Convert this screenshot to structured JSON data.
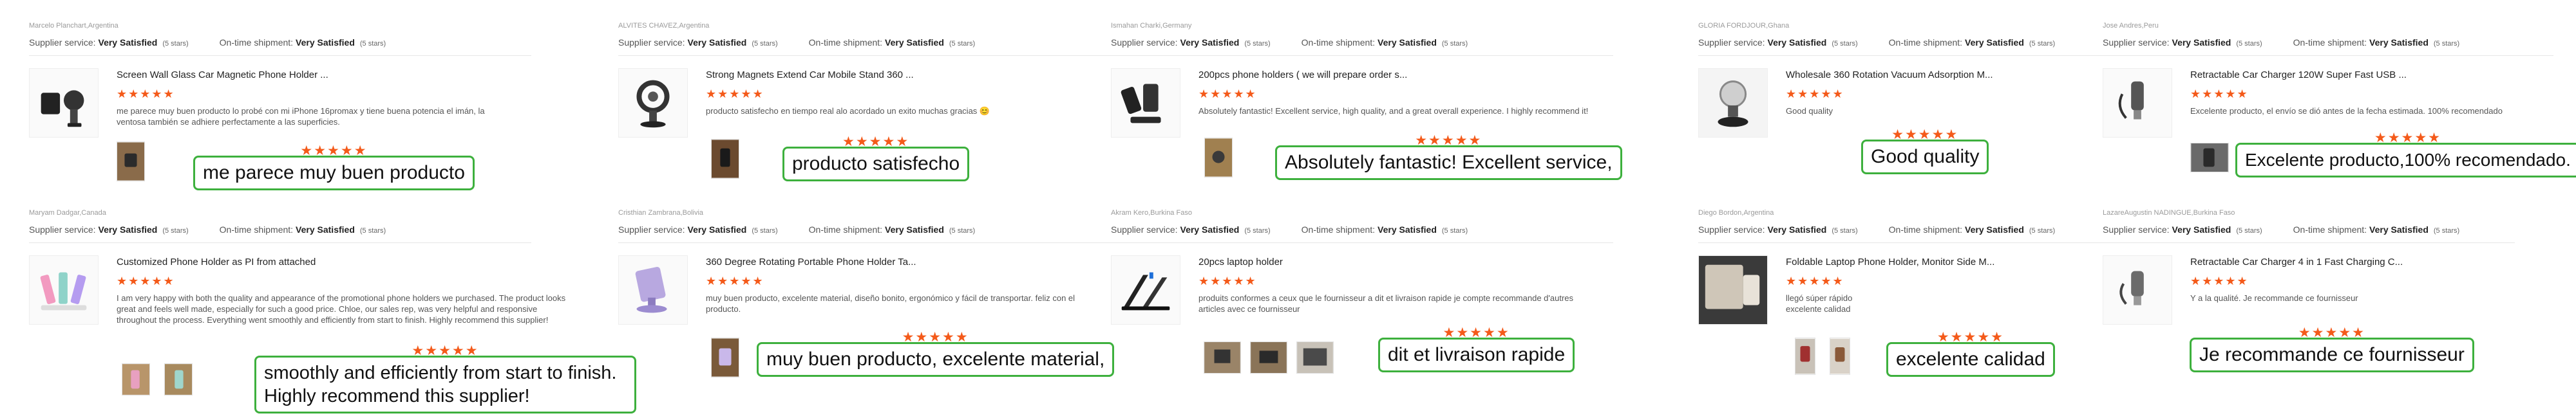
{
  "labels": {
    "supplier_service": "Supplier service:",
    "on_time_shipment": "On-time shipment:"
  },
  "stars_glyph": "★★★★★",
  "colors": {
    "star": "#f45a1a",
    "highlight_border": "#3db03d",
    "divider": "#e6e6e6"
  },
  "reviews": [
    {
      "reviewer": "Marcelo Planchart,Argentina",
      "supplier_value": "Very Satisfied",
      "supplier_stars": "(5 stars)",
      "shipment_value": "Very Satisfied",
      "shipment_stars": "(5 stars)",
      "product_title": "Screen Wall Glass Car Magnetic Phone Holder ...",
      "review_text": "me parece muy buen producto lo probé con mi iPhone 16promax y tiene buena potencia el imán, la ventosa también se adhiere perfectamente a las superficies.",
      "highlight": "me parece muy buen producto",
      "thumb_icon": "magnetic-phone-holder-icon",
      "photos": 1
    },
    {
      "reviewer": "ALVITES CHAVEZ,Argentina",
      "supplier_value": "Very Satisfied",
      "supplier_stars": "(5 stars)",
      "shipment_value": "Very Satisfied",
      "shipment_stars": "(5 stars)",
      "product_title": "Strong Magnets Extend Car Mobile Stand 360 ...",
      "review_text": "producto satisfecho en tiempo real alo acordado un exito muchas gracias 😊",
      "highlight": "producto satisfecho",
      "thumb_icon": "magnetic-stand-icon",
      "photos": 1
    },
    {
      "reviewer": "Ismahan Charki,Germany",
      "supplier_value": "Very Satisfied",
      "supplier_stars": "(5 stars)",
      "shipment_value": "Very Satisfied",
      "shipment_stars": "(5 stars)",
      "product_title": "200pcs phone holders ( we will prepare order s...",
      "review_text": "Absolutely fantastic! Excellent service, high quality, and a great overall experience. I highly recommend it!",
      "highlight": "Absolutely fantastic! Excellent service,",
      "thumb_icon": "phone-holder-set-icon",
      "photos": 1
    },
    {
      "reviewer": "GLORIA FORDJOUR,Ghana",
      "supplier_value": "Very Satisfied",
      "supplier_stars": "(5 stars)",
      "shipment_value": "Very Satisfied",
      "shipment_stars": "(5 stars)",
      "product_title": "Wholesale 360 Rotation Vacuum Adsorption M...",
      "review_text": "Good quality",
      "highlight": "Good quality",
      "thumb_icon": "vacuum-mount-icon",
      "photos": 0
    },
    {
      "reviewer": "Jose Andres,Peru",
      "supplier_value": "Very Satisfied",
      "supplier_stars": "(5 stars)",
      "shipment_value": "Very Satisfied",
      "shipment_stars": "(5 stars)",
      "product_title": "Retractable Car Charger 120W Super Fast USB ...",
      "review_text": "Excelente producto, el envío se dió antes de la fecha estimada. 100% recomendado",
      "highlight": "Excelente producto,100% recomendado.",
      "thumb_icon": "car-charger-icon",
      "photos": 1
    },
    {
      "reviewer": "Maryam Dadgar,Canada",
      "supplier_value": "Very Satisfied",
      "supplier_stars": "(5 stars)",
      "shipment_value": "Very Satisfied",
      "shipment_stars": "(5 stars)",
      "product_title": "Customized Phone Holder as PI from attached",
      "review_text": "I am very happy with both the quality and appearance of the promotional phone holders we purchased. The product looks great and feels well made, especially for such a good price. Chloe, our sales rep, was very helpful and responsive throughout the process. Everything went smoothly and efficiently from start to finish. Highly recommend this supplier!",
      "highlight": "smoothly and efficiently from start to finish. Highly recommend this supplier!",
      "thumb_icon": "colorful-phone-stand-icon",
      "photos": 2
    },
    {
      "reviewer": "Cristhian Zambrana,Bolivia",
      "supplier_value": "Very Satisfied",
      "supplier_stars": "(5 stars)",
      "shipment_value": "Very Satisfied",
      "shipment_stars": "(5 stars)",
      "product_title": "360 Degree Rotating Portable Phone Holder Ta...",
      "review_text": "muy buen producto, excelente material, diseño bonito, ergonómico y fácil de transportar. feliz con el producto.",
      "highlight": "muy buen producto, excelente material,",
      "thumb_icon": "rotating-holder-icon",
      "photos": 1
    },
    {
      "reviewer": "Akram Kero,Burkina Faso",
      "supplier_value": "Very Satisfied",
      "supplier_stars": "(5 stars)",
      "shipment_value": "Very Satisfied",
      "shipment_stars": "(5 stars)",
      "product_title": "20pcs laptop holder",
      "review_text": "produits conformes a ceux que le fournisseur a dit et livraison rapide je compte recommande d'autres articles avec ce fournisseur",
      "highlight": "dit et livraison rapide",
      "thumb_icon": "laptop-stand-icon",
      "photos": 3
    },
    {
      "reviewer": "Diego Bordon,Argentina",
      "supplier_value": "Very Satisfied",
      "supplier_stars": "(5 stars)",
      "shipment_value": "Very Satisfied",
      "shipment_stars": "(5 stars)",
      "product_title": "Foldable Laptop Phone Holder, Monitor Side M...",
      "review_text": "llegó súper rápido excelente calidad",
      "highlight": "excelente calidad",
      "thumb_icon": "monitor-side-holder-icon",
      "photos": 2
    },
    {
      "reviewer": "LazareAugustin NADINGUE,Burkina Faso",
      "supplier_value": "Very Satisfied",
      "supplier_stars": "(5 stars)",
      "shipment_value": "Very Satisfied",
      "shipment_stars": "(5 stars)",
      "product_title": "Retractable Car Charger 4 in 1 Fast Charging C...",
      "review_text": "Y a la qualité. Je recommande ce fournisseur",
      "highlight": "Je recommande ce fournisseur",
      "thumb_icon": "car-charger-icon",
      "photos": 0
    }
  ]
}
